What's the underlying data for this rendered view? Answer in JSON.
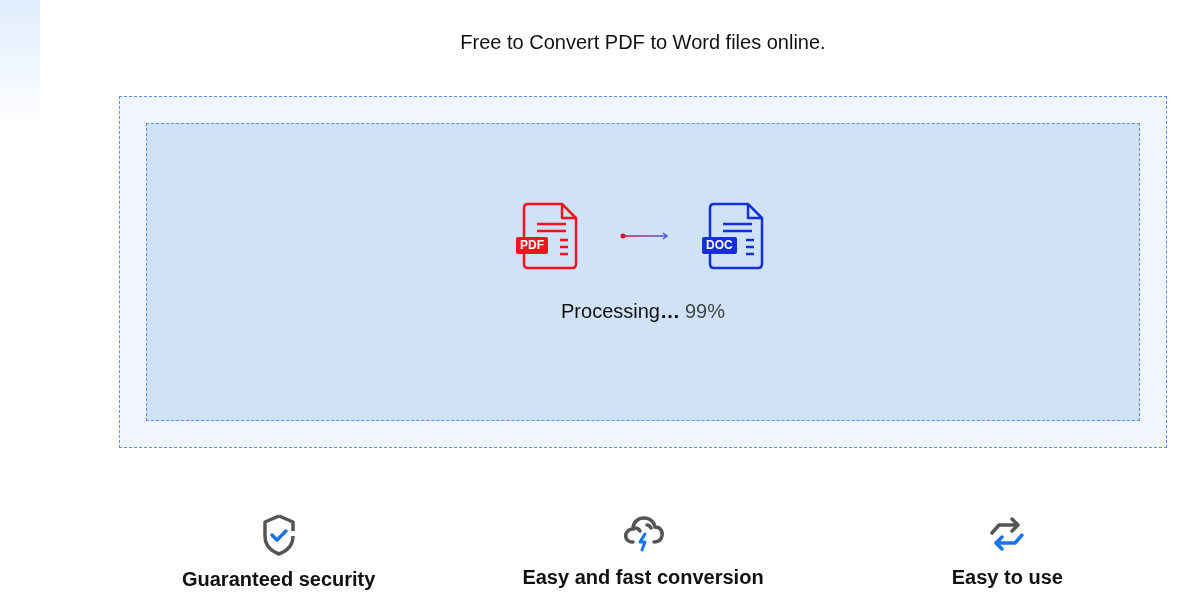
{
  "headline": "Free to Convert PDF to Word files online.",
  "converter": {
    "source_badge": "PDF",
    "target_badge": "DOC",
    "status": "Processing**…**",
    "percent": "99%"
  },
  "features": [
    {
      "kind": "security",
      "label": "Guaranteed security"
    },
    {
      "kind": "speed",
      "label": "Easy and fast conversion"
    },
    {
      "kind": "ease",
      "label": "Easy to use"
    }
  ]
}
